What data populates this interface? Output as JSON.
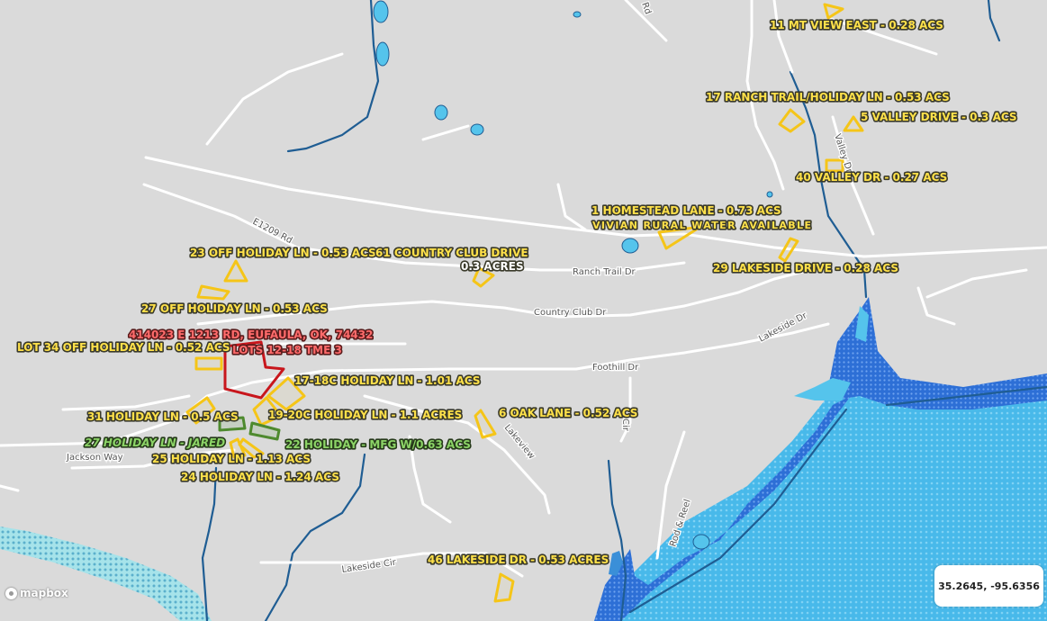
{
  "map": {
    "attribution": "mapbox",
    "coordinates": "35.2645, -95.6356"
  },
  "roads": {
    "e1209": "E1209 Rd",
    "ranch_trail": "Ranch Trail Dr",
    "country_club": "Country Club Dr",
    "foothill": "Foothill Dr",
    "lakeside_dr": "Lakeside Dr",
    "lakeview": "Lakeview",
    "jackson": "Jackson Way",
    "lakeside_cir": "Lakeside Cir",
    "rod_reel": "Rod & Reel",
    "valley": "Valley Dr",
    "cir": "Cir",
    "top_rd": "Rd"
  },
  "labels": {
    "mt_view_east": "11 MT VIEW EAST - 0.28 ACS",
    "ranch_trail_holiday": "17 RANCH TRAIL/HOLIDAY LN - 0.53 ACS",
    "valley_drive_5": "5 VALLEY DRIVE - 0.3 ACS",
    "valley_dr_40": "40 VALLEY DR - 0.27 ACS",
    "homestead": "1 HOMESTEAD LANE - 0.73 ACS",
    "vivian_water": "VIVIAN RURAL WATER AVAILABLE",
    "lakeside_29": "29 LAKESIDE DRIVE - 0.28 ACS",
    "off_holiday_23": "23 OFF HOLIDAY LN - 0.53 ACS",
    "country_club_61": "61 COUNTRY CLUB DRIVE",
    "country_club_61_acres": "0.3 ACRES",
    "off_holiday_27": "27 OFF HOLIDAY LN - 0.53 ACS",
    "address_414023": "414023 E 1213 RD, EUFAULA, OK, 74432",
    "lots_12_18": "LOTS 12-18 TME 3",
    "lot_34": "LOT 34 OFF HOLIDAY LN - 0.52 ACS",
    "holiday_17_18c": "17-18C HOLIDAY LN - 1.01 ACS",
    "holiday_31": "31 HOLIDAY LN - 0.5 ACS",
    "holiday_19_20c": "19-20C HOLIDAY LN - 1.1 ACRES",
    "oak_lane_6": "6 OAK LANE - 0.52 ACS",
    "holiday_27_jared": "27 HOLIDAY LN - JARED",
    "holiday_22_mfg": "22 HOLIDAY - MFG W/0.63 ACS",
    "holiday_25": "25 HOLIDAY LN - 1.13 ACS",
    "holiday_24": "24 HOLIDAY LN - 1.24 ACS",
    "lakeside_46": "46 LAKESIDE DR - 0.53 ACRES"
  }
}
